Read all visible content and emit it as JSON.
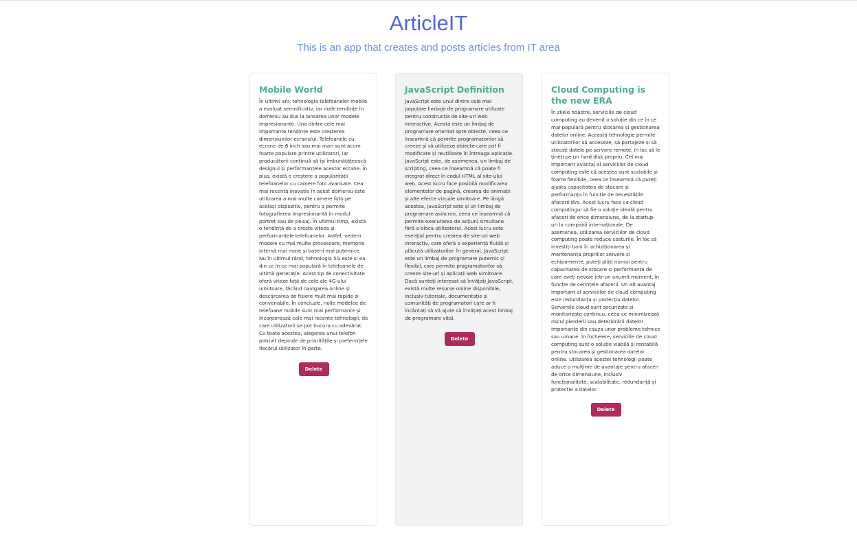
{
  "app": {
    "title": "ArticleIT",
    "subtitle": "This is an app that creates and posts articles from IT area"
  },
  "colors": {
    "title": "#4f66e2",
    "subtitle": "#6f8ff0",
    "card_title": "#4bb08a",
    "delete_button": "#b02a5b",
    "active_card_bg": "#f2f3f5"
  },
  "articles": [
    {
      "title": "Mobile World",
      "body": "În ultimii ani, tehnologia telefoanelor mobile a evoluat semnificativ, iar noile tendințe în domeniu au dus la lansarea unor modele impresionante. Una dintre cele mai importante tendințe este creșterea dimensiunilor ecranului. Telefoanele cu ecrane de 6 inch sau mai mari sunt acum foarte populare printre utilizatori, iar producătorii continuă să își îmbunătățească designul și performanțele acestor ecrane. În plus, există o creștere a popularității telefoanelor cu camere foto avansate. Cea mai recentă inovație în acest domeniu este utilizarea a mai multe camere foto pe același dispozitiv, pentru a permite fotografierea impresionantă în modul portret sau de peisaj. În ultimul timp, există o tendință de a crește viteza și performanțele telefoanelor. Astfel, vedem modele cu mai multe procesoare, memorie internă mai mare și baterii mai puternice. Nu în ultimul rând, tehnologia 5G este și ea din ce în ce mai populară în telefoanele de ultimă generație. Acest tip de conectivitate oferă viteze față de cele ale 4G-ului uimitoare, făcând navigarea online și descărcarea de fișiere mult mai rapide și convenabile. În concluzie, noile modelee de telefoane mobile sunt mai performante și încorporează cele mai recente tehnologii, de care utilizatorii se pot bucura cu adevărat. Cu toate acestea, alegerea unui telefon potrivit depinde de prioritățile și preferințele fiecărui utilizator în parte.",
      "delete_label": "Delete"
    },
    {
      "title": "JavaScript Definition",
      "body": "JavaScript este unul dintre cele mai populare limbaje de programare utilizate pentru construcția de site-uri web interactive. Acesta este un limbaj de programare orientat spre obiecte, ceea ce înseamnă că permite programatorilor să creeze și să utilizeze obiecte care pot fi modificate și reutilizate în întreaga aplicație. JavaScript este, de asemenea, un limbaj de scripting, ceea ce înseamnă că poate fi integrat direct în codul HTML al site-ului web. Acest lucru face posibilă modificarea elementelor de pagină, crearea de animații și alte efecte vizuale uimitoare. Pe lângă acestea, JavaScript este și un limbaj de programare asincron, ceea ce înseamnă că permite executarea de acțiuni simultane fără a bloca utilizatorul. Acest lucru este esențial pentru crearea de site-uri web interactiv, care oferă o experiență fluidă și plăcută utilizatorilor. În general, JavaScript este un limbaj de programare puternic și flexibil, care permite programatorilor să creeze site-uri și aplicații web uimitoare. Dacă sunteți interesat să învățați JavaScript, există multe resurse online disponibile, inclusiv tutoriale, documentație și comunități de programatori care ar fi încântați să vă ajute să învățați acest limbaj de programare vital.",
      "delete_label": "Delete"
    },
    {
      "title": "Cloud Computing is the new ERA",
      "body": "În zilele noastre, serviciile de cloud computing au devenit o soluție din ce în ce mai populară pentru stocarea și gestionarea datelor online. Această tehnologie permite utilizatorilor să acceseze, să partajeze și să stocați datele pe servere remote, în loc să le țineți pe un hard disk propriu. Cel mai important avantaj al serviciilor de cloud computing este că acestea sunt scalabile și foarte flexibile, ceea ce înseamnă că puteți ajusta capacitatea de stocare și performanța în funcție de necesitățile afacerii dvs. Acest lucru face ca cloud computingul să fie o soluție ideală pentru afaceri de orice dimensiune, de la startup-uri la companii internaționale. De asemenea, utilizarea serviciilor de cloud computing poate reduce costurile. În loc să investiți bani în achiziționarea și mentenanța propriilor servere și echipamente, puteți plăti numai pentru capacitatea de stocare și performanță de care aveți nevoie într-un anumit moment, în funcție de cerințele afacerii. Un alt avantaj important al serviciilor de cloud computing este redundanța și protecția datelor. Serverele cloud sunt securizate și monitorizate continuu, ceea ce minimizează riscul pierderii sau deteriorării datelor importante din cauza unor probleme tehnice sau umane. În încheiere, serviciile de cloud computing sunt o soluție viabilă și rentabilă pentru stocarea și gestionarea datelor online. Utilizarea acestei tehnologii poate aduce o mulțime de avantaje pentru afaceri de orice dimensiune, inclusiv funcționalitate, scalabilitate, redundanță și protecție a datelor.",
      "delete_label": "Delete"
    }
  ]
}
